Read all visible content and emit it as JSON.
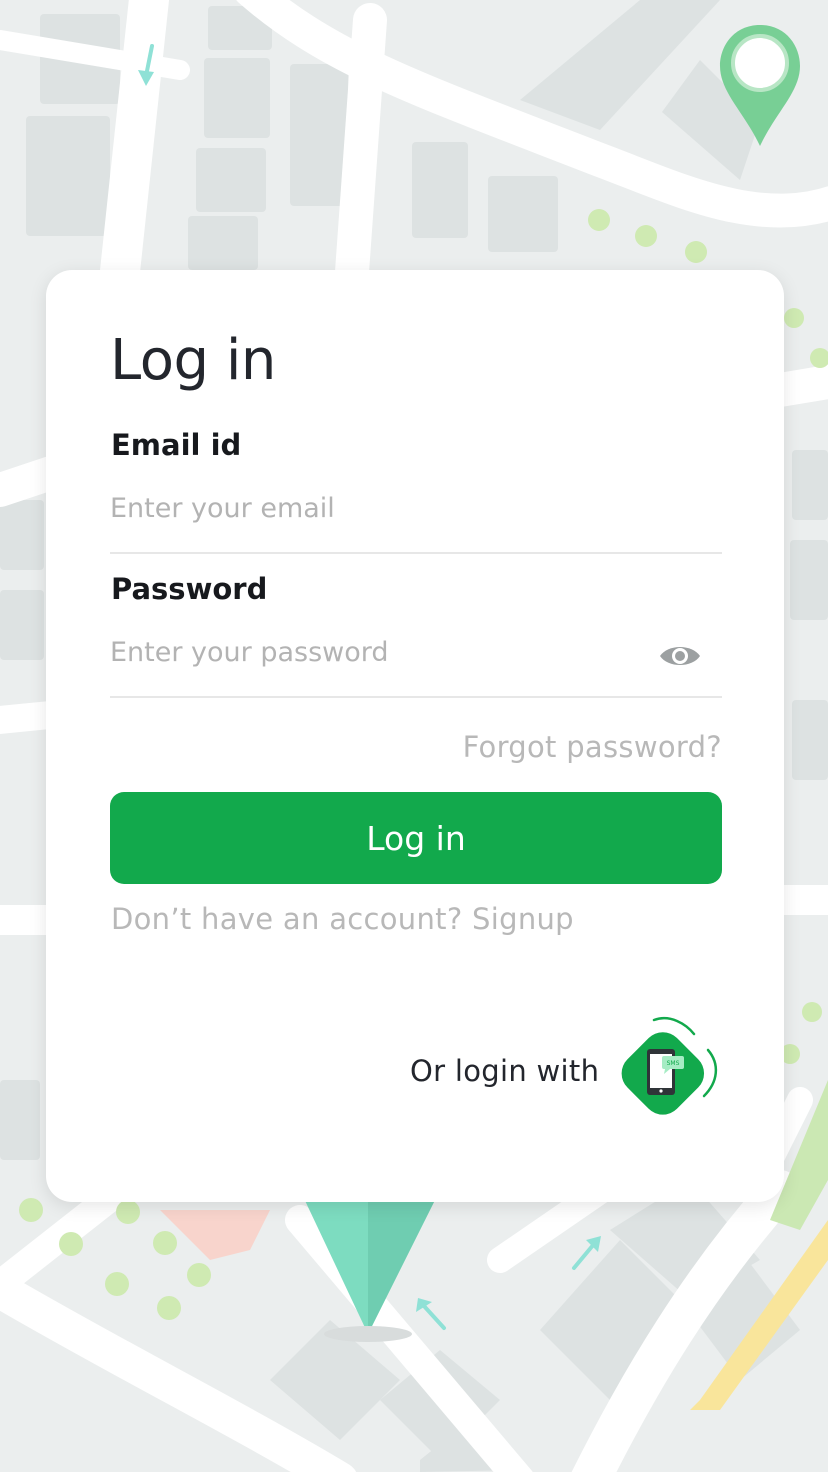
{
  "login": {
    "title": "Log in",
    "email_label": "Email id",
    "email_placeholder": "Enter your email",
    "email_value": "",
    "password_label": "Password",
    "password_placeholder": "Enter your password",
    "password_value": "",
    "forgot_password": "Forgot password?",
    "login_button": "Log in",
    "signup_prompt": "Don’t have an account? Signup",
    "alt_login_prompt": "Or login with",
    "sms_badge": "SMS"
  },
  "icons": {
    "password_toggle": "eye-icon",
    "alt_login": "sms-phone-icon",
    "map_pin": "map-pin-icon",
    "map_arrow": "arrow-icon"
  },
  "colors": {
    "primary": "#12a94c",
    "pin_green": "#78cf95",
    "pin_teal": "#7ddcc0",
    "map_background": "#ebeeee",
    "road": "#ffffff",
    "building": "#dde2e2",
    "park_dot": "#cfeab2"
  }
}
